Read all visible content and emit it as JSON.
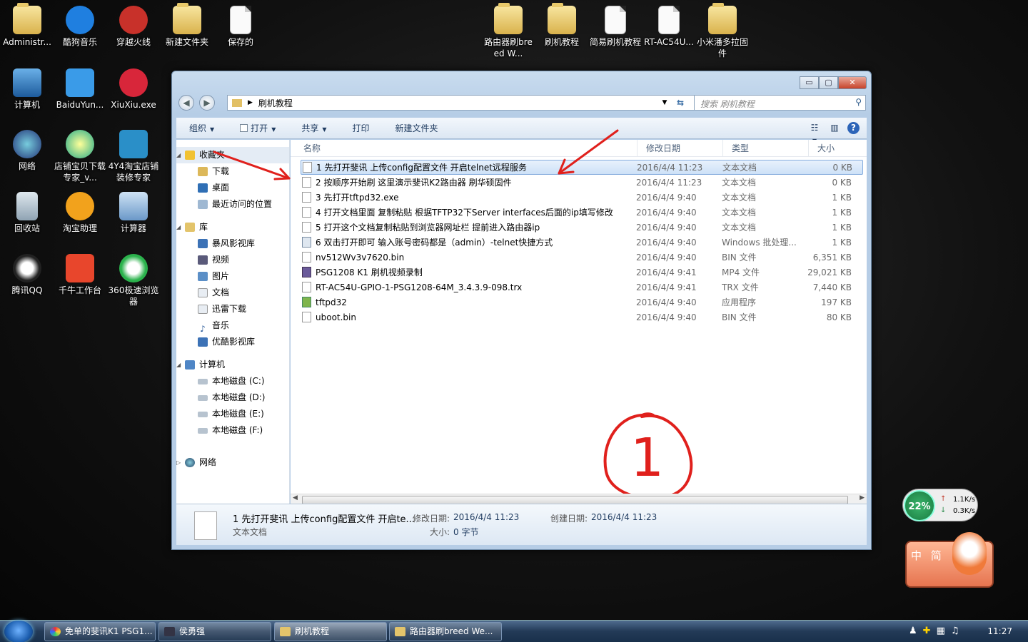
{
  "desktop_icons": [
    {
      "label": "Administr...",
      "icon": "user-folder-icon"
    },
    {
      "label": "酷狗音乐",
      "icon": "kugou-icon"
    },
    {
      "label": "穿越火线",
      "icon": "crossfire-icon"
    },
    {
      "label": "新建文件夹",
      "icon": "folder-icon"
    },
    {
      "label": "保存的",
      "icon": "document-icon"
    },
    {
      "label": "计算机",
      "icon": "computer-icon"
    },
    {
      "label": "BaiduYun...",
      "icon": "baiduyun-icon"
    },
    {
      "label": "XiuXiu.exe",
      "icon": "xiuxiu-icon"
    },
    {
      "label": "网络",
      "icon": "network-icon"
    },
    {
      "label": "店铺宝贝下载专家_v...",
      "icon": "shop-tool-icon"
    },
    {
      "label": "4Y4淘宝店铺装修专家",
      "icon": "4y4-icon"
    },
    {
      "label": "回收站",
      "icon": "recycle-bin-icon"
    },
    {
      "label": "淘宝助理",
      "icon": "taobao-assistant-icon"
    },
    {
      "label": "计算器",
      "icon": "calculator-icon"
    },
    {
      "label": "腾讯QQ",
      "icon": "qq-icon"
    },
    {
      "label": "千牛工作台",
      "icon": "qianniu-icon"
    },
    {
      "label": "360极速浏览器",
      "icon": "360-browser-icon"
    },
    {
      "label": "路由器刷breed W...",
      "icon": "folder-icon"
    },
    {
      "label": "刷机教程",
      "icon": "folder-icon"
    },
    {
      "label": "简易刷机教程",
      "icon": "document-icon"
    },
    {
      "label": "RT-AC54U...",
      "icon": "document-icon"
    },
    {
      "label": "小米潘多拉固件",
      "icon": "folder-icon"
    }
  ],
  "window": {
    "path": "刷机教程",
    "search_placeholder": "搜索 刷机教程",
    "caption": {
      "min": "▭",
      "max": "▢",
      "close": "✕"
    }
  },
  "toolbar": {
    "organize": "组织",
    "open": "打开",
    "share": "共享",
    "print": "打印",
    "new_folder": "新建文件夹"
  },
  "nav": {
    "favorites": "收藏夹",
    "fav_items": [
      "下载",
      "桌面",
      "最近访问的位置"
    ],
    "libraries": "库",
    "lib_items": [
      "暴风影视库",
      "视频",
      "图片",
      "文档",
      "迅雷下载",
      "音乐",
      "优酷影视库"
    ],
    "computer": "计算机",
    "drives": [
      "本地磁盘 (C:)",
      "本地磁盘 (D:)",
      "本地磁盘 (E:)",
      "本地磁盘 (F:)"
    ],
    "network": "网络"
  },
  "columns": {
    "name": "名称",
    "date": "修改日期",
    "type": "类型",
    "size": "大小"
  },
  "files": [
    {
      "name": "1 先打开斐讯 上传config配置文件 开启telnet远程服务",
      "date": "2016/4/4 11:23",
      "type": "文本文档",
      "size": "0 KB",
      "icon": "text-file-icon"
    },
    {
      "name": "2 按顺序开始刷 这里演示斐讯K2路由器 刷华硕固件",
      "date": "2016/4/4 11:23",
      "type": "文本文档",
      "size": "0 KB",
      "icon": "text-file-icon"
    },
    {
      "name": "3 先打开tftpd32.exe",
      "date": "2016/4/4 9:40",
      "type": "文本文档",
      "size": "1 KB",
      "icon": "text-file-icon"
    },
    {
      "name": "4 打开文档里面 复制粘贴 根据TFTP32下Server interfaces后面的ip填写修改",
      "date": "2016/4/4 9:40",
      "type": "文本文档",
      "size": "1 KB",
      "icon": "text-file-icon"
    },
    {
      "name": "5 打开这个文档复制粘贴到浏览器网址栏 提前进入路由器ip",
      "date": "2016/4/4 9:40",
      "type": "文本文档",
      "size": "1 KB",
      "icon": "text-file-icon"
    },
    {
      "name": "6 双击打开即可 输入账号密码都是（admin）-telnet快捷方式",
      "date": "2016/4/4 9:40",
      "type": "Windows 批处理...",
      "size": "1 KB",
      "icon": "batch-file-icon"
    },
    {
      "name": "nv512Wv3v7620.bin",
      "date": "2016/4/4 9:40",
      "type": "BIN 文件",
      "size": "6,351 KB",
      "icon": "bin-file-icon"
    },
    {
      "name": "PSG1208 K1 刷机视频录制",
      "date": "2016/4/4 9:41",
      "type": "MP4 文件",
      "size": "29,021 KB",
      "icon": "video-file-icon"
    },
    {
      "name": "RT-AC54U-GPIO-1-PSG1208-64M_3.4.3.9-098.trx",
      "date": "2016/4/4 9:41",
      "type": "TRX 文件",
      "size": "7,440 KB",
      "icon": "trx-file-icon"
    },
    {
      "name": "tftpd32",
      "date": "2016/4/4 9:40",
      "type": "应用程序",
      "size": "197 KB",
      "icon": "app-icon"
    },
    {
      "name": "uboot.bin",
      "date": "2016/4/4 9:40",
      "type": "BIN 文件",
      "size": "80 KB",
      "icon": "bin-file-icon"
    }
  ],
  "annotation": {
    "numeral": "1"
  },
  "details": {
    "name": "1 先打开斐讯 上传config配置文件 开启te...",
    "type": "文本文档",
    "modified_label": "修改日期:",
    "modified": "2016/4/4 11:23",
    "created_label": "创建日期:",
    "created": "2016/4/4 11:23",
    "size_label": "大小:",
    "size": "0 字节"
  },
  "taskbar": {
    "tasks": [
      "免单的斐讯K1 PSG1...",
      "侯勇强",
      "刷机教程",
      "路由器刷breed We..."
    ],
    "clock": "11:27"
  },
  "net_widget": {
    "percent": "22%",
    "up": "1.1K/s",
    "down": "0.3K/s"
  },
  "ime": {
    "label": "中 简"
  },
  "colors": {
    "selection": "#cde1f7",
    "annotation": "#e0201c",
    "titlebar": "#b6cde6"
  }
}
